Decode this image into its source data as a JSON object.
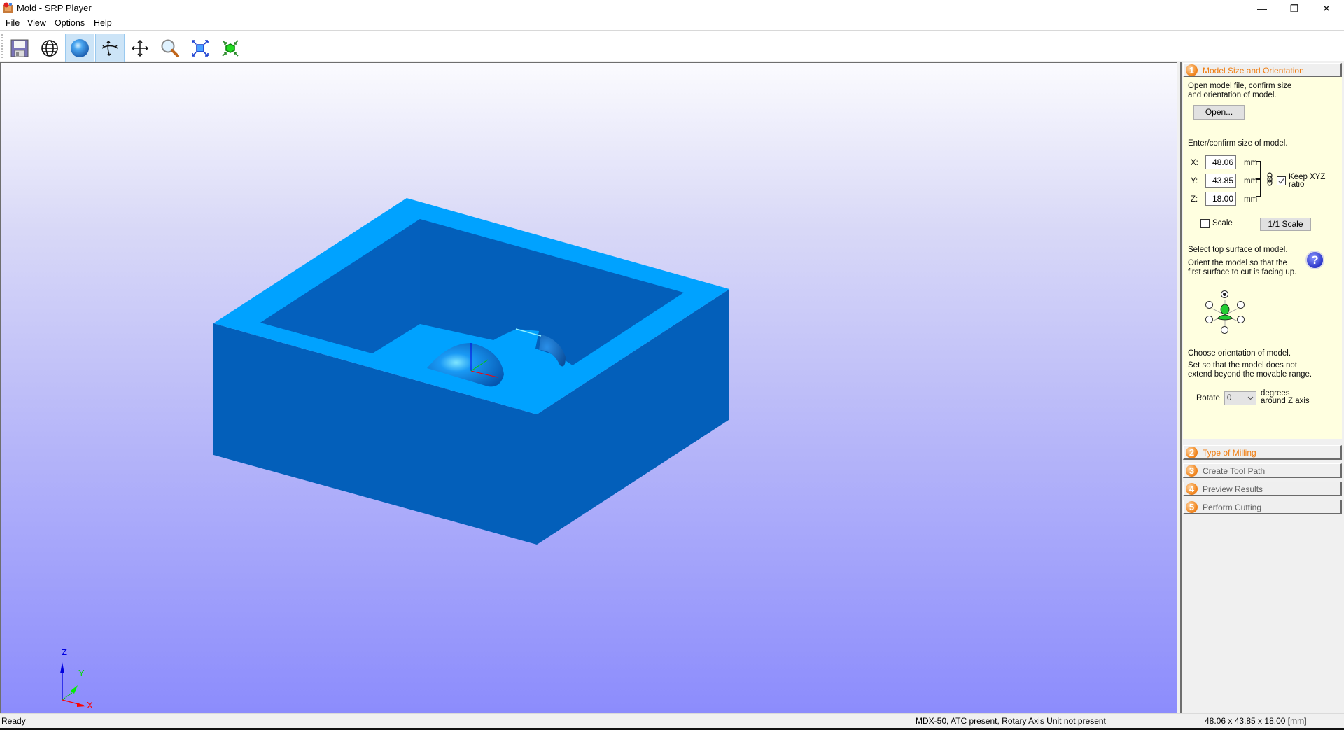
{
  "window": {
    "title": "Mold - SRP Player",
    "controls": {
      "minimize": "—",
      "restore": "❐",
      "close": "✕"
    }
  },
  "menu": [
    "File",
    "View",
    "Options",
    "Help"
  ],
  "toolbar": {
    "buttons": [
      {
        "name": "save",
        "icon": "floppy-disk-icon",
        "active": false
      },
      {
        "name": "wireframe-view",
        "icon": "wireframe-globe-icon",
        "active": false
      },
      {
        "name": "shaded-view",
        "icon": "shaded-sphere-icon",
        "active": true
      },
      {
        "name": "rotate-view",
        "icon": "rotate-arrows-icon",
        "active": true
      },
      {
        "name": "pan-view",
        "icon": "move-arrows-icon",
        "active": false
      },
      {
        "name": "zoom-view",
        "icon": "magnifier-icon",
        "active": false
      },
      {
        "name": "fit-to-window",
        "icon": "fit-expand-icon",
        "active": false
      },
      {
        "name": "fit-model",
        "icon": "green-cube-shrink-icon",
        "active": false
      }
    ]
  },
  "viewport": {
    "axis_labels": {
      "x": "X",
      "y": "Y",
      "z": "Z"
    },
    "colors": {
      "top_face": "#00a2ff",
      "side_face": "#035fba",
      "axis_x": "#ff0000",
      "axis_y": "#00cc00",
      "axis_z": "#0000e0"
    }
  },
  "panel": {
    "steps": [
      {
        "number": "1",
        "label": "Model Size and Orientation",
        "state": "active"
      },
      {
        "number": "2",
        "label": "Type of Milling",
        "state": "next"
      },
      {
        "number": "3",
        "label": "Create Tool Path",
        "state": "disabled"
      },
      {
        "number": "4",
        "label": "Preview Results",
        "state": "disabled"
      },
      {
        "number": "5",
        "label": "Perform Cutting",
        "state": "disabled"
      }
    ],
    "step1": {
      "intro": "Open model file, confirm size and orientation of model.",
      "open_button": "Open...",
      "size_label": "Enter/confirm size of model.",
      "size": {
        "x": {
          "label": "X:",
          "value": "48.06",
          "unit": "mm"
        },
        "y": {
          "label": "Y:",
          "value": "43.85",
          "unit": "mm"
        },
        "z": {
          "label": "Z:",
          "value": "18.00",
          "unit": "mm"
        }
      },
      "keep_ratio_label": "Keep XYZ ratio",
      "keep_ratio_checked": true,
      "scale_label": "Scale",
      "scale_checked": false,
      "one_to_one_button": "1/1 Scale",
      "top_surface_title": "Select top surface of model.",
      "top_surface_desc": "Orient the model so that the first surface to cut is facing up.",
      "top_surface_selected": "top",
      "orientation_title": "Choose orientation of model.",
      "orientation_desc": "Set so that the model does not extend beyond the movable range.",
      "rotate_label": "Rotate",
      "rotate_value": "0",
      "rotate_unit": "degrees around Z axis"
    }
  },
  "status": {
    "left": "Ready",
    "machine": "MDX-50, ATC present, Rotary Axis Unit not present",
    "dimensions": "48.06 x  43.85 x  18.00 [mm]"
  }
}
